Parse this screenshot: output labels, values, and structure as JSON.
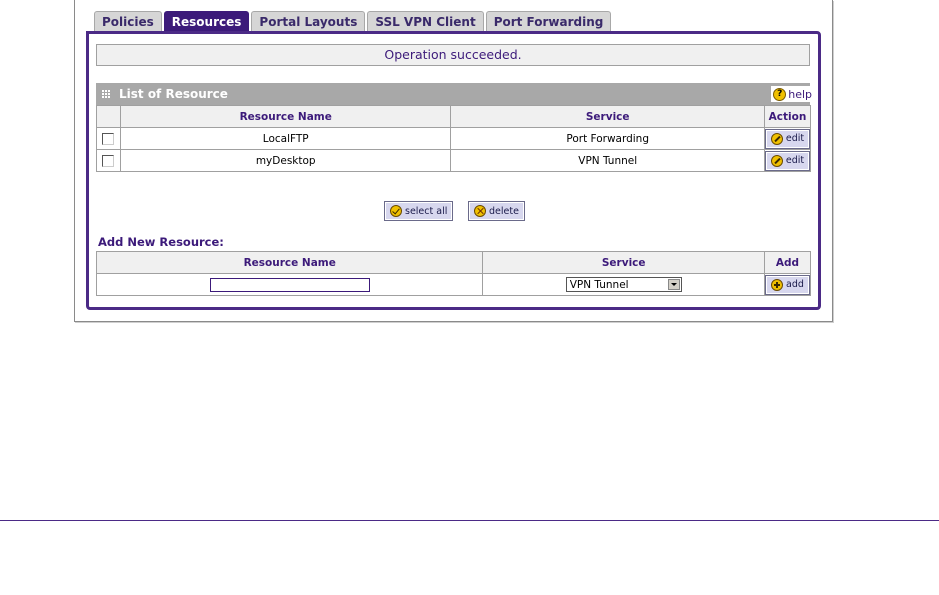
{
  "tabs": [
    {
      "label": "Policies",
      "active": false
    },
    {
      "label": "Resources",
      "active": true
    },
    {
      "label": "Portal Layouts",
      "active": false
    },
    {
      "label": "SSL VPN Client",
      "active": false
    },
    {
      "label": "Port Forwarding",
      "active": false
    }
  ],
  "status_message": "Operation succeeded.",
  "list_section": {
    "title": "List of Resource",
    "help_label": "help",
    "columns": [
      "Resource Name",
      "Service",
      "Action"
    ],
    "rows": [
      {
        "name": "LocalFTP",
        "service": "Port Forwarding",
        "action": "edit",
        "checked": false
      },
      {
        "name": "myDesktop",
        "service": "VPN Tunnel",
        "action": "edit",
        "checked": false
      }
    ]
  },
  "buttons": {
    "select_all": "select all",
    "delete": "delete"
  },
  "add_section": {
    "title": "Add New Resource:",
    "columns": [
      "Resource Name",
      "Service",
      "Add"
    ],
    "name_value": "",
    "service_selected": "VPN Tunnel",
    "add_label": "add"
  },
  "colors": {
    "accent": "#4b2a86",
    "active_tab": "#3c1a7a",
    "section_bar": "#a8a8a8",
    "icon_yellow": "#f0c000"
  }
}
